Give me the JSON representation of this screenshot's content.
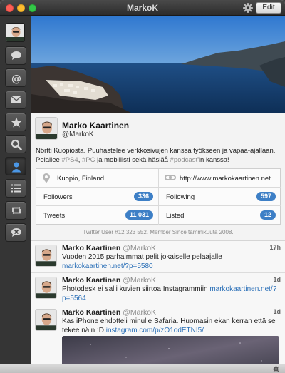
{
  "window": {
    "title": "MarkoK",
    "edit_label": "Edit"
  },
  "icons": {
    "settings": "gear-icon",
    "sidebar": [
      "speech-bubble-icon",
      "at-icon",
      "envelope-icon",
      "star-icon",
      "search-icon",
      "profile-icon",
      "list-icon",
      "retweet-icon",
      "mute-icon"
    ]
  },
  "profile": {
    "name": "Marko Kaartinen",
    "handle": "@MarkoK",
    "bio_parts": {
      "p1": "Nörtti Kuopiosta. Puuhastelee verkkosivujen kanssa työkseen ja vapaa-ajallaan. Pelailee ",
      "tag_ps4": "#PS4",
      "p2": ", ",
      "tag_pc": "#PC",
      "p3": " ja mobiilisti sekä häsläå ",
      "tag_podcast": "#podcast",
      "p4": "'in kanssa!"
    },
    "location": "Kuopio, Finland",
    "website": "http://www.markokaartinen.net",
    "stats": {
      "followers_label": "Followers",
      "followers": "336",
      "following_label": "Following",
      "following": "597",
      "tweets_label": "Tweets",
      "tweets": "11 031",
      "listed_label": "Listed",
      "listed": "12"
    },
    "member_since": "Twitter User #12 323 552. Member Since tammikuuta 2008."
  },
  "tweets": [
    {
      "name": "Marko Kaartinen",
      "handle": "@MarkoK",
      "time": "17h",
      "text": "Vuoden 2015 parhaimmat pelit jokaiselle pelaajalle ",
      "link": "markokaartinen.net/?p=5580"
    },
    {
      "name": "Marko Kaartinen",
      "handle": "@MarkoK",
      "time": "1d",
      "text": "Photodesk ei salli kuvien siirtoa Instagrammiin ",
      "link": "markokaartinen.net/?p=5564"
    },
    {
      "name": "Marko Kaartinen",
      "handle": "@MarkoK",
      "time": "1d",
      "text": "Kas iPhone ehdotteli minulle Safaria. Huomasin ekan kerran että se tekee näin :D ",
      "link": "instagram.com/p/zO1odETNI5/"
    }
  ],
  "colors": {
    "accent": "#3d7fc6",
    "link": "#2a6fb7",
    "titlebar": "#3b3b3b",
    "sidebar": "#353535"
  }
}
